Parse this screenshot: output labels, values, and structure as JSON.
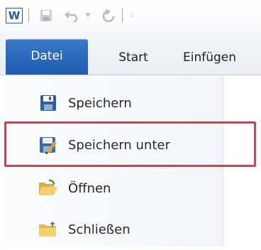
{
  "quick_access": {
    "app_logo_letter": "W",
    "icons": [
      "word-logo-icon",
      "save-icon",
      "undo-icon",
      "undo-dropdown-icon",
      "redo-icon",
      "customize-toolbar-icon"
    ]
  },
  "tabs": {
    "file": "Datei",
    "start": "Start",
    "insert": "Einfügen"
  },
  "menu": {
    "items": [
      {
        "label": "Speichern",
        "icon": "save-icon"
      },
      {
        "label": "Speichern unter",
        "icon": "save-as-icon"
      },
      {
        "label": "Öffnen",
        "icon": "open-folder-icon"
      },
      {
        "label": "Schließen",
        "icon": "close-folder-icon"
      }
    ],
    "highlighted_item": "Speichern unter"
  },
  "colors": {
    "file_tab": "#2a6bc0",
    "highlight_border": "#c4474f"
  }
}
